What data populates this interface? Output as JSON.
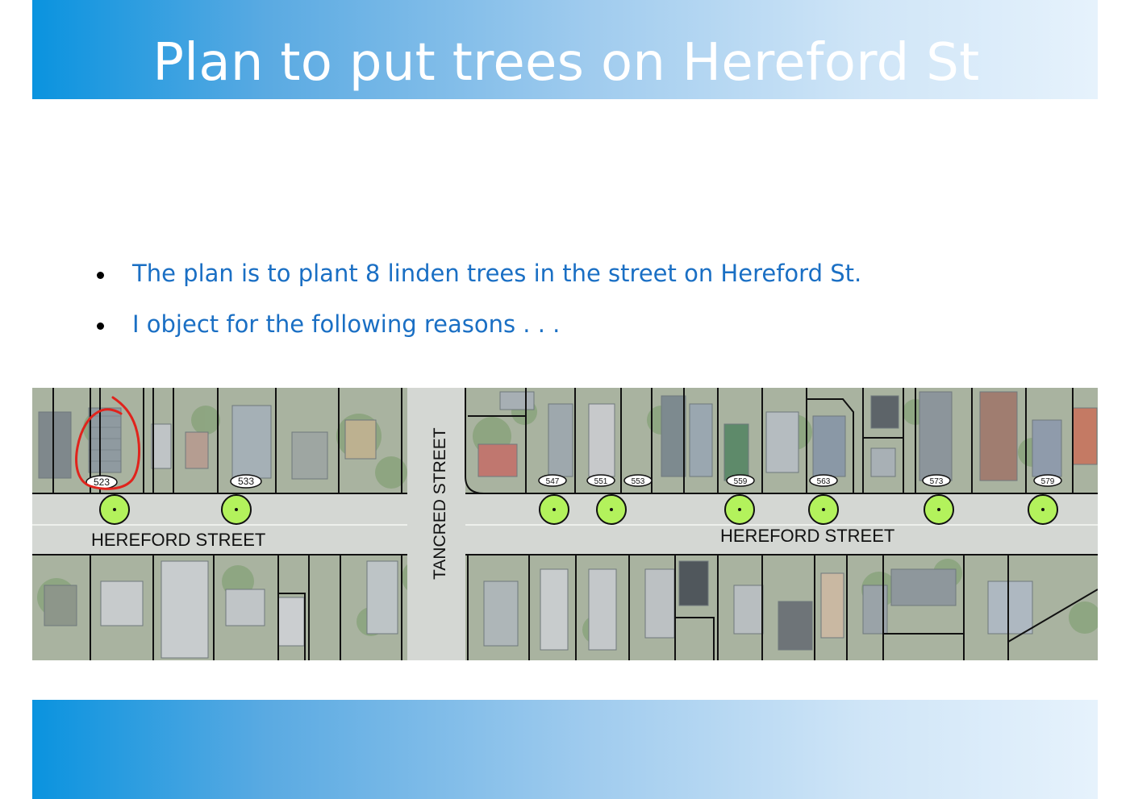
{
  "title": "Plan to put trees on Hereford St",
  "bullets": [
    "The plan is to plant 8 linden trees in the street on Hereford St.",
    "I object for the following reasons . . ."
  ],
  "map": {
    "street_labels": {
      "hereford_left": "HEREFORD STREET",
      "hereford_right": "HEREFORD STREET",
      "tancred": "TANCRED STREET"
    },
    "house_numbers": [
      "523",
      "533",
      "547",
      "551",
      "553",
      "559",
      "563",
      "573",
      "579"
    ],
    "tree_count": 8,
    "colors": {
      "tree_fill": "#b3f25c",
      "annotation": "#e0231c",
      "road": "#d6d8d5",
      "lot": "#aab5a3"
    }
  }
}
